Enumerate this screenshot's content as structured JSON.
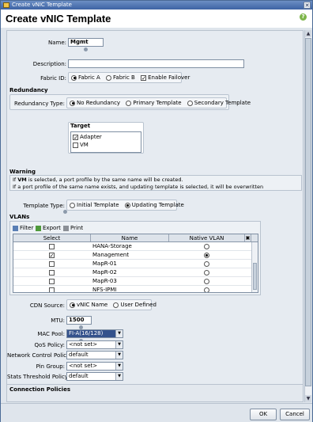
{
  "window": {
    "title": "Create vNIC Template",
    "heading": "Create vNIC Template"
  },
  "form": {
    "name_label": "Name:",
    "name_value": "Mgmt",
    "description_label": "Description:",
    "description_value": "",
    "fabric_id_label": "Fabric ID:",
    "fabric_a": "Fabric A",
    "fabric_b": "Fabric B",
    "enable_failover": "Enable Failover",
    "redundancy_title": "Redundancy",
    "redundancy_type_label": "Redundancy Type:",
    "no_redundancy": "No Redundancy",
    "primary_template": "Primary Template",
    "secondary_template": "Secondary Template",
    "target_title": "Target",
    "target_adapter": "Adapter",
    "target_vm": "VM",
    "warning_title": "Warning",
    "warning_line1_a": "If ",
    "warning_line1_vm": "VM",
    "warning_line1_b": " is selected, a port profile by the same name will be created.",
    "warning_line2": "If a port profile of the same name exists, and updating template is selected, it will be overwritten",
    "template_type_label": "Template Type:",
    "initial_template": "Initial Template",
    "updating_template": "Updating Template",
    "vlans_title": "VLANs",
    "filter_label": "Filter",
    "export_label": "Export",
    "print_label": "Print",
    "cdn_source_label": "CDN Source:",
    "vnic_name": "vNIC Name",
    "user_defined": "User Defined",
    "mtu_label": "MTU:",
    "mtu_value": "1500",
    "mac_pool_label": "MAC Pool:",
    "mac_pool_value": "FI-A(16/128)",
    "qos_policy_label": "QoS Policy:",
    "qos_policy_value": "<not set>",
    "network_control_label": "Network Control Policy:",
    "network_control_value": "default",
    "pin_group_label": "Pin Group:",
    "pin_group_value": "<not set>",
    "stats_threshold_label": "Stats Threshold Policy:",
    "stats_threshold_value": "default",
    "connection_policies_title": "Connection Policies"
  },
  "vlan_table": {
    "columns": [
      "Select",
      "Name",
      "Native VLAN"
    ],
    "rows": [
      {
        "name": "HANA-Storage",
        "selected": false,
        "native": false
      },
      {
        "name": "Management",
        "selected": true,
        "native": true
      },
      {
        "name": "MapR-01",
        "selected": false,
        "native": false
      },
      {
        "name": "MapR-02",
        "selected": false,
        "native": false
      },
      {
        "name": "MapR-03",
        "selected": false,
        "native": false
      },
      {
        "name": "NFS-IPMI",
        "selected": false,
        "native": false
      }
    ]
  },
  "footer": {
    "ok": "OK",
    "cancel": "Cancel"
  }
}
